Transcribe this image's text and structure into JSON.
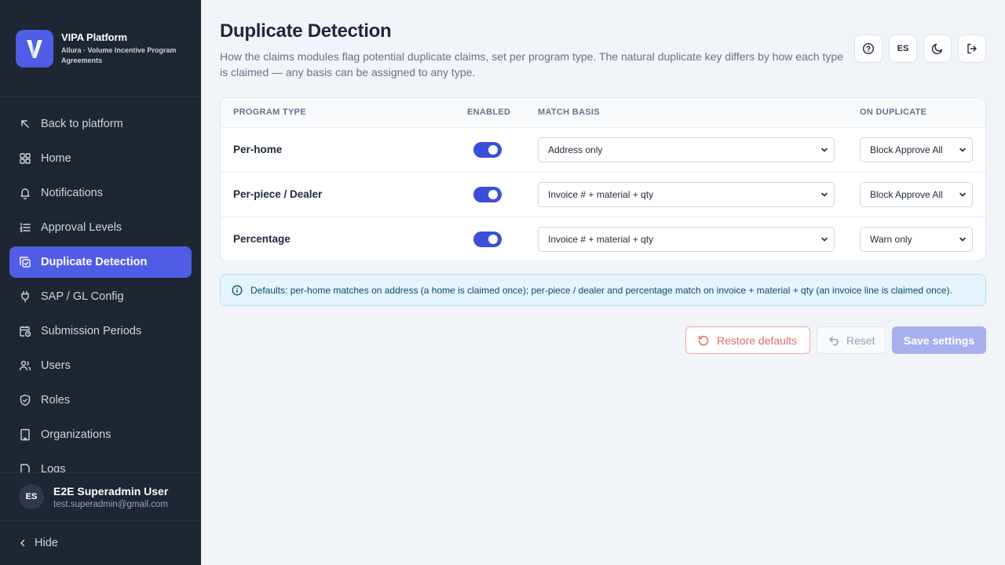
{
  "sidebar": {
    "brand_title": "VIPA Platform",
    "brand_subtitle": "Allura · Volume Incentive Program Agreements",
    "items": [
      {
        "label": "Back to platform",
        "icon": "arrow-up-left-icon",
        "active": false
      },
      {
        "label": "Home",
        "icon": "grid-icon",
        "active": false
      },
      {
        "label": "Notifications",
        "icon": "bell-icon",
        "active": false
      },
      {
        "label": "Approval Levels",
        "icon": "list-ordered-icon",
        "active": false
      },
      {
        "label": "Duplicate Detection",
        "icon": "copy-check-icon",
        "active": true
      },
      {
        "label": "SAP / GL Config",
        "icon": "plug-icon",
        "active": false
      },
      {
        "label": "Submission Periods",
        "icon": "calendar-clock-icon",
        "active": false
      },
      {
        "label": "Users",
        "icon": "users-icon",
        "active": false
      },
      {
        "label": "Roles",
        "icon": "shield-check-icon",
        "active": false
      },
      {
        "label": "Organizations",
        "icon": "building-icon",
        "active": false
      },
      {
        "label": "Logs",
        "icon": "file-icon",
        "active": false
      }
    ],
    "user": {
      "initials": "ES",
      "name": "E2E Superadmin User",
      "email": "test.superadmin@gmail.com"
    },
    "hide_label": "Hide"
  },
  "header": {
    "title": "Duplicate Detection",
    "subtitle": "How the claims modules flag potential duplicate claims, set per program type. The natural duplicate key differs by how each type is claimed — any basis can be assigned to any type.",
    "lang_label": "ES"
  },
  "table": {
    "headers": [
      "PROGRAM TYPE",
      "ENABLED",
      "MATCH BASIS",
      "ON DUPLICATE"
    ],
    "rows": [
      {
        "program_type": "Per-home",
        "enabled": true,
        "match_basis": "Address only",
        "on_duplicate": "Block Approve All"
      },
      {
        "program_type": "Per-piece / Dealer",
        "enabled": true,
        "match_basis": "Invoice # + material + qty",
        "on_duplicate": "Block Approve All"
      },
      {
        "program_type": "Percentage",
        "enabled": true,
        "match_basis": "Invoice # + material + qty",
        "on_duplicate": "Warn only"
      }
    ]
  },
  "info_text": "Defaults: per-home matches on address (a home is claimed once); per-piece / dealer and percentage match on invoice + material + qty (an invoice line is claimed once).",
  "actions": {
    "restore_label": "Restore defaults",
    "reset_label": "Reset",
    "save_label": "Save settings"
  },
  "colors": {
    "accent": "#4f5de6",
    "sidebar_bg": "#1e2533",
    "toggle_on": "#3b4fd8",
    "info_bg": "#e4f3fc",
    "danger": "#e56b6b"
  }
}
